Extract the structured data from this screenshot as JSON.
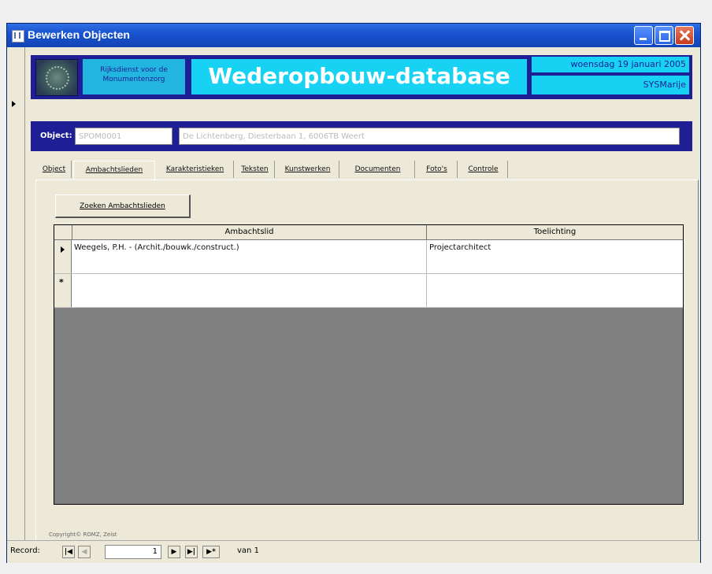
{
  "window": {
    "title": "Bewerken Objecten"
  },
  "header": {
    "agency": "Rijksdienst voor de Monumentenzorg",
    "app_title": "Wederopbouw-database",
    "date": "woensdag 19 januari 2005",
    "user": "SYSMarije"
  },
  "object": {
    "label": "Object:",
    "code": "SPOM0001",
    "description": "De Lichtenberg, Diesterbaan 1, 6006TB Weert"
  },
  "tabs": [
    {
      "label": "Object"
    },
    {
      "label": "Ambachtslieden"
    },
    {
      "label": "Karakteristieken"
    },
    {
      "label": "Teksten"
    },
    {
      "label": "Kunstwerken"
    },
    {
      "label": "Documenten"
    },
    {
      "label": "Foto's"
    },
    {
      "label": "Controle"
    }
  ],
  "search_button": {
    "label": "Zoeken Ambachtslieden"
  },
  "grid": {
    "columns": [
      "Ambachtslid",
      "Toelichting"
    ],
    "rows": [
      {
        "ambachtslid": "Weegels, P.H. -  (Archit./bouwk./construct.)",
        "toelichting": "Projectarchitect"
      }
    ],
    "new_row_marker": "*"
  },
  "copyright": "Copyright© ROMZ, Zeist",
  "navigation": {
    "record_label": "Record:",
    "current": "1",
    "of_label": "van 1",
    "first": "|◀",
    "prev": "◀",
    "next": "▶",
    "last": "▶|",
    "new": "▶*"
  }
}
